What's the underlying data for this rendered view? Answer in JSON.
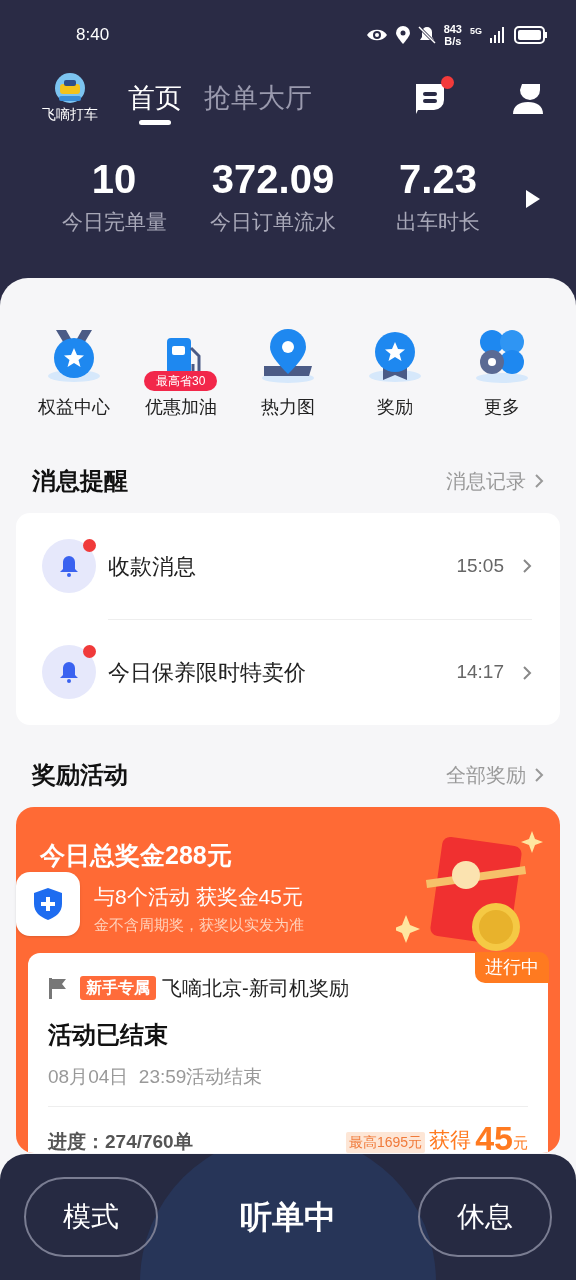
{
  "status_bar": {
    "time": "8:40",
    "net_speed": "843",
    "net_unit": "B/s",
    "network": "5G"
  },
  "header": {
    "logo_text": "飞嘀打车",
    "tabs": [
      {
        "label": "首页",
        "selected": true
      },
      {
        "label": "抢单大厅",
        "selected": false
      }
    ],
    "message_unread": true
  },
  "stats": [
    {
      "value": "10",
      "label": "今日完单量"
    },
    {
      "value": "372.09",
      "label": "今日订单流水"
    },
    {
      "value": "7.23",
      "label": "出车时长"
    }
  ],
  "shortcuts": [
    {
      "kind": "medal",
      "label": "权益中心"
    },
    {
      "kind": "fuel",
      "label": "优惠加油",
      "badge": "最高省30"
    },
    {
      "kind": "pin",
      "label": "热力图"
    },
    {
      "kind": "award",
      "label": "奖励"
    },
    {
      "kind": "more",
      "label": "更多"
    }
  ],
  "messages_section": {
    "title": "消息提醒",
    "link": "消息记录"
  },
  "messages": [
    {
      "title": "收款消息",
      "time": "15:05",
      "unread": true
    },
    {
      "title": "今日保养限时特卖价",
      "time": "14:17",
      "unread": true
    }
  ],
  "rewards_section": {
    "title": "奖励活动",
    "link": "全部奖励"
  },
  "reward_banner": {
    "title": "今日总奖金288元",
    "subtitle": "与8个活动 获奖金45元",
    "note": "金不含周期奖，获奖以实发为准"
  },
  "activity": {
    "status": "进行中",
    "tag": "新手专属",
    "name": "飞嘀北京-新司机奖励",
    "headline": "活动已结束",
    "end_time": "08月04日  23:59活动结束",
    "progress": "进度：274/760单",
    "max_reward": "最高1695元",
    "earned_label": "获得",
    "earned_amount": "45",
    "earned_unit": "元"
  },
  "bottom_bar": {
    "left": "模式",
    "center": "听单中",
    "right": "休息"
  }
}
